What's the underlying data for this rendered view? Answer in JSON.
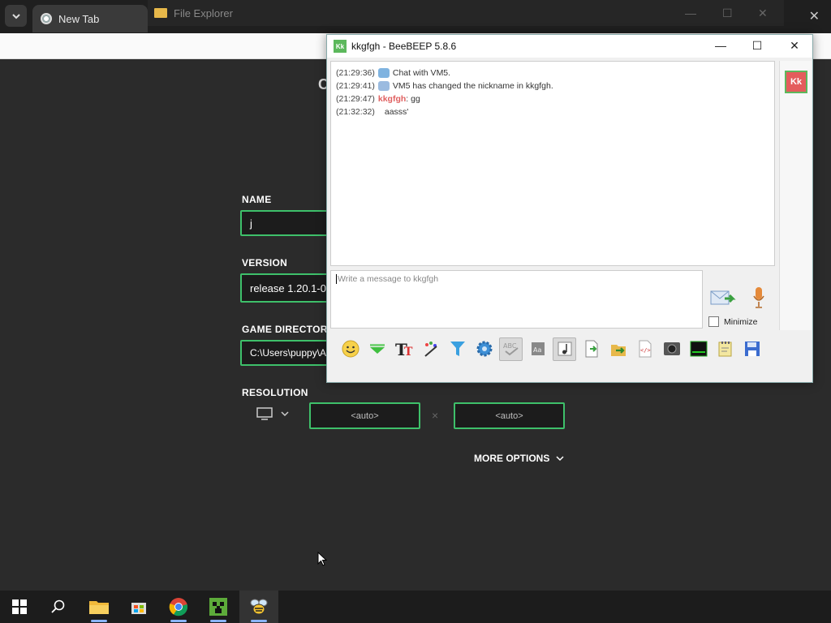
{
  "browser": {
    "tab_title": "New Tab",
    "close_glyph": "✕"
  },
  "file_explorer": {
    "title": "File Explorer"
  },
  "launcher": {
    "heading_fragment": "C",
    "name_label": "NAME",
    "name_value": "j",
    "version_label": "VERSION",
    "version_value": "release 1.20.1-0",
    "game_dir_label": "GAME DIRECTORY",
    "game_dir_value": "C:\\Users\\puppy\\A",
    "resolution_label": "RESOLUTION",
    "res_width": "<auto>",
    "res_height": "<auto>",
    "res_separator": "×",
    "more_options": "MORE OPTIONS"
  },
  "beebeep": {
    "title": "kkgfgh - BeeBEEP 5.8.6",
    "icon_text": "Kk",
    "messages": [
      {
        "time": "(21:29:36)",
        "nick": "",
        "text": "Chat with VM5."
      },
      {
        "time": "(21:29:41)",
        "nick": "",
        "text": "VM5 has changed the nickname in kkgfgh."
      },
      {
        "time": "(21:29:47)",
        "nick": "kkgfgh",
        "text": ": gg"
      },
      {
        "time": "(21:32:32)",
        "nick": "",
        "text": "aasss'"
      }
    ],
    "input_placeholder": "Write a message to kkgfgh",
    "minimize_label": "Minimize",
    "avatar_text": "Kk",
    "toolbar_icons": [
      "emoticon-icon",
      "color-marker-icon",
      "font-icon",
      "palette-icon",
      "filter-icon",
      "settings-icon",
      "spellcheck-icon",
      "dictionary-icon",
      "music-note-icon",
      "file-icon",
      "send-file-icon",
      "html-icon",
      "screenshot-icon",
      "terminal-icon",
      "notes-icon",
      "save-icon"
    ]
  },
  "taskbar": {
    "items": [
      "windows-start-icon",
      "search-icon",
      "file-explorer-icon",
      "store-icon",
      "chrome-icon",
      "minecraft-icon",
      "beebeep-icon"
    ]
  },
  "colors": {
    "field_border": "#3ec06a",
    "nick": "#e06060"
  }
}
